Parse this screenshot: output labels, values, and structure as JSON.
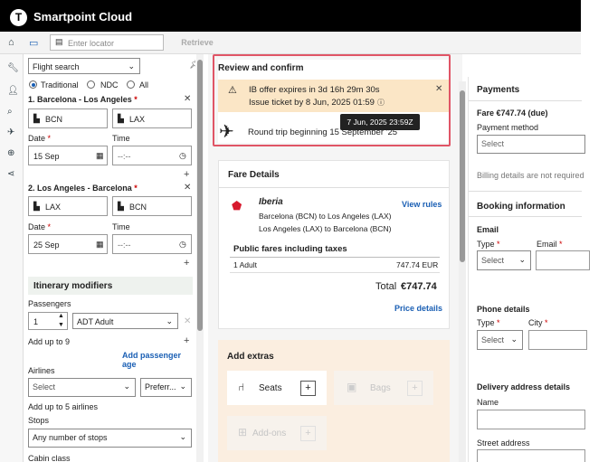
{
  "app": {
    "title": "Smartpoint Cloud",
    "logo_letter": "T"
  },
  "toolbar": {
    "locator_placeholder": "Enter locator",
    "retrieve_label": "Retrieve"
  },
  "search_panel": {
    "mode_select": "Flight search",
    "radios": {
      "traditional": "Traditional",
      "ndc": "NDC",
      "all": "All"
    },
    "segments": [
      {
        "title": "1. Barcelona - Los Angeles",
        "origin": "BCN",
        "destination": "LAX",
        "date_label": "Date",
        "date": "15 Sep",
        "time_label": "Time",
        "time_placeholder": "--:--"
      },
      {
        "title": "2. Los Angeles - Barcelona",
        "origin": "LAX",
        "destination": "BCN",
        "date_label": "Date",
        "date": "25 Sep",
        "time_label": "Time",
        "time_placeholder": "--:--"
      }
    ],
    "modifiers": {
      "heading": "Itinerary modifiers",
      "passengers_label": "Passengers",
      "passenger_count": "1",
      "passenger_type": "ADT Adult",
      "add_up_to_passengers": "Add up to 9",
      "add_passenger_age": "Add passenger age",
      "airlines_label": "Airlines",
      "airline_placeholder": "Select",
      "airline_preference": "Preferr...",
      "add_up_to_airlines": "Add up to 5 airlines",
      "stops_label": "Stops",
      "stops_value": "Any number of stops",
      "cabin_label": "Cabin class"
    }
  },
  "review": {
    "heading": "Review and confirm",
    "warning_line1": "IB offer expires in 3d 16h 29m 30s",
    "warning_line2": "Issue ticket by 8 Jun, 2025 01:59",
    "tooltip": "7 Jun, 2025 23:59Z",
    "trip_text": "Round trip beginning 15 September '25"
  },
  "fare_details": {
    "heading": "Fare Details",
    "airline_logo_text": "Iberia",
    "view_rules": "View rules",
    "routes": [
      "Barcelona (BCN) to Los Angeles (LAX)",
      "Los Angeles (LAX) to Barcelona (BCN)"
    ],
    "public_fares_heading": "Public fares including taxes",
    "row_label": "1 Adult",
    "row_amount": "747.74 EUR",
    "total_label": "Total",
    "total_amount": "€747.74",
    "price_details": "Price details"
  },
  "extras": {
    "heading": "Add extras",
    "seats": "Seats",
    "bags": "Bags",
    "addons": "Add-ons"
  },
  "payments": {
    "heading": "Payments",
    "fare_line": "Fare €747.74 (due)",
    "method_label": "Payment method",
    "method_placeholder": "Select",
    "billing_text": "Billing details are not required"
  },
  "booking": {
    "heading": "Booking information",
    "email_section": "Email",
    "type_label": "Type",
    "email_label": "Email",
    "type_placeholder": "Select",
    "phone_section": "Phone details",
    "phone_type_label": "Type",
    "city_label": "City",
    "phone_type_placeholder": "Select",
    "delivery_section": "Delivery address details",
    "name_label": "Name",
    "street_label": "Street address"
  },
  "colors": {
    "accent_blue": "#1a5fb4",
    "highlight_outline": "#e05566",
    "warning_bg": "#fbe6c6",
    "extras_bg": "#fbeee0"
  }
}
